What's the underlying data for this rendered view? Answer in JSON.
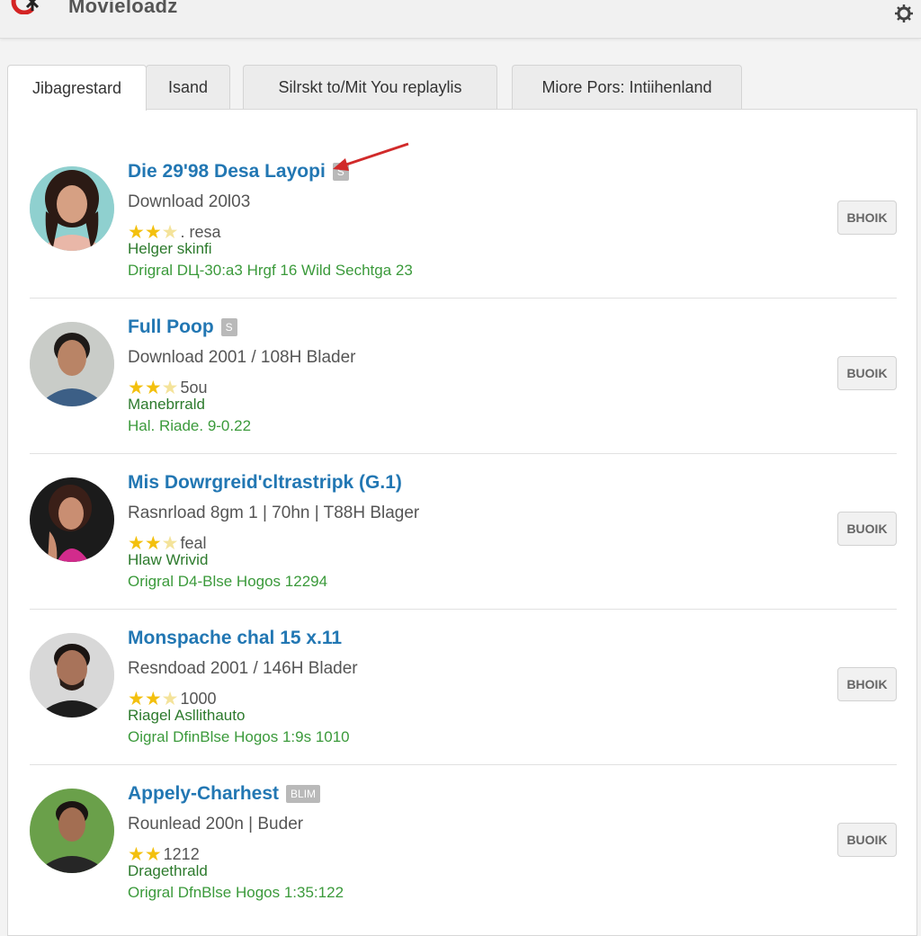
{
  "app": {
    "title": "Movieloadz",
    "logo_icon": "logo-icon",
    "settings_icon": "gear-icon"
  },
  "tabs": [
    {
      "label": "Jibagrestard",
      "active": true
    },
    {
      "label": "Isand",
      "active": false
    },
    {
      "label": "Silrskt to/Mit You replaylis",
      "active": false
    },
    {
      "label": "Miore Pors: Intiihenland",
      "active": false
    }
  ],
  "items": [
    {
      "title": "Die 29'98 Desa Layopi",
      "tag": "S",
      "meta": "Download 20l03",
      "stars_filled": 2,
      "rating_text": ". resa",
      "line1": "Helger skinfi",
      "line2": "Drigral DЦ-30:a3 Hrgf 16 Wild Sechtga 23",
      "button": "BHOIK"
    },
    {
      "title": "Full Poop",
      "tag": "S",
      "meta": "Download 2001  /  108H Blader",
      "stars_filled": 2,
      "rating_text": "5ou",
      "line1": "Manebrrald",
      "line2": "Hal. Riade. 9-0.22",
      "button": "BUOIK"
    },
    {
      "title": "Mis Dowrgreid'cltrastripk (G.1)",
      "tag": "",
      "meta": "Rasnrload 8gm 1  |  70hn  |  T88H Blager",
      "stars_filled": 2,
      "rating_text": "feal",
      "line1": "Hlaw Wrivid",
      "line2": "Origral D4-Blse Hogos 12294",
      "button": "BUOIK"
    },
    {
      "title": "Monspache chal 15 x.11",
      "tag": "",
      "meta": "Resndoad 2001  /  146H Blader",
      "stars_filled": 2,
      "rating_text": "1000",
      "line1": "Riagel Asllithauto",
      "line2": "Oigral DfinBlse Hogos 1:9s 1010",
      "button": "BHOIK"
    },
    {
      "title": "Appely-Charhest",
      "tag": "BLIM",
      "meta": "Rounlead 200n | Buder",
      "stars_filled": 2,
      "rating_text": "1212",
      "line1": "Dragethrald",
      "line2": "Origral DfnBlse Hogos 1:35:122",
      "button": "BUOIK"
    }
  ],
  "colors": {
    "title_link": "#2277b3",
    "green_text": "#3b9a3b",
    "star": "#f3c00e",
    "arrow": "#d12a2a"
  }
}
